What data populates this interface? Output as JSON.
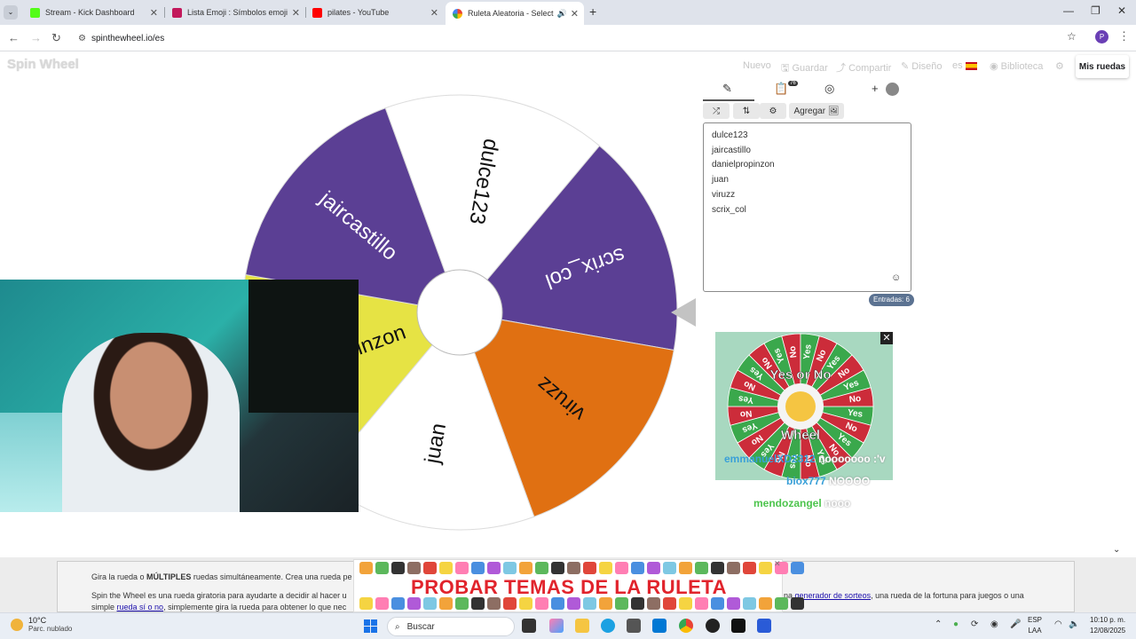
{
  "browser": {
    "tabs": [
      {
        "title": "Stream - Kick Dashboard",
        "favicon_color": "#53fc18"
      },
      {
        "title": "Lista Emoji : Símbolos emoji na",
        "favicon_color": "#c2185b"
      },
      {
        "title": "pilates - YouTube",
        "favicon_color": "#ff0000"
      },
      {
        "title": "Ruleta Aleatoria - Selector",
        "favicon_color": "#4285f4"
      }
    ],
    "url": "spinthewheel.io/es",
    "profile_initial": "P"
  },
  "site": {
    "logo": "Spin Wheel",
    "nav": [
      "Nuevo",
      "Guardar",
      "Compartir",
      "Diseño",
      "es",
      "Biblioteca"
    ],
    "my_wheels": "Mis ruedas"
  },
  "wheel": {
    "segments": [
      {
        "label": "dulce123",
        "color": "#ffffff",
        "text_color": "#111111"
      },
      {
        "label": "scrix_col",
        "color": "#5b3f94",
        "text_color": "#ffffff"
      },
      {
        "label": "viruzz",
        "color": "#e07012",
        "text_color": "#111111"
      },
      {
        "label": "juan",
        "color": "#ffffff",
        "text_color": "#111111"
      },
      {
        "label": "danielpropinzon",
        "color": "#e6e344",
        "text_color": "#111111"
      },
      {
        "label": "jaircastillo",
        "color": "#5b3f94",
        "text_color": "#ffffff"
      }
    ]
  },
  "panel": {
    "badge": "76",
    "add_label": "Agregar",
    "entries": [
      "dulce123",
      "jaircastillo",
      "danielpropinzon",
      "juan",
      "viruzz",
      "scrix_col"
    ],
    "count_label": "Entradas: 6"
  },
  "ad": {
    "title": "Yes or No",
    "subtitle": "Wheel",
    "slices": [
      "Yes",
      "No"
    ]
  },
  "chat": [
    {
      "user": "emmanuelXD2312",
      "message": "nooooooo :'v",
      "color": "#3aa0d8"
    },
    {
      "user": "biox777",
      "message": "NOOOO",
      "color": "#3aa0d8"
    },
    {
      "user": "mendozangel",
      "message": "nooo",
      "color": "#4cc44c"
    }
  ],
  "content": {
    "line1_a": "Gira la rueda o ",
    "line1_b": "MÚLTIPLES",
    "line1_c": " ruedas simultáneamente. Crea una rueda pe",
    "line2_a": "Spin the Wheel es una rueda giratoria para ayudarte a decidir al hacer u",
    "line2_b": "na ",
    "line2_link": "generador de sorteos",
    "line2_c": ", una rueda de la fortuna para juegos o una",
    "line3_a": "simple ",
    "line3_link": "rueda sí o no",
    "line3_b": ", simplemente gira la rueda para obtener lo que nec"
  },
  "banner": {
    "title": "PROBAR TEMAS DE LA RULETA"
  },
  "taskbar": {
    "temp": "10°C",
    "condition": "Parc. nublado",
    "search_placeholder": "Buscar",
    "lang1": "ESP",
    "lang2": "LAA",
    "time": "10:10 p. m.",
    "date": "12/08/2025"
  }
}
